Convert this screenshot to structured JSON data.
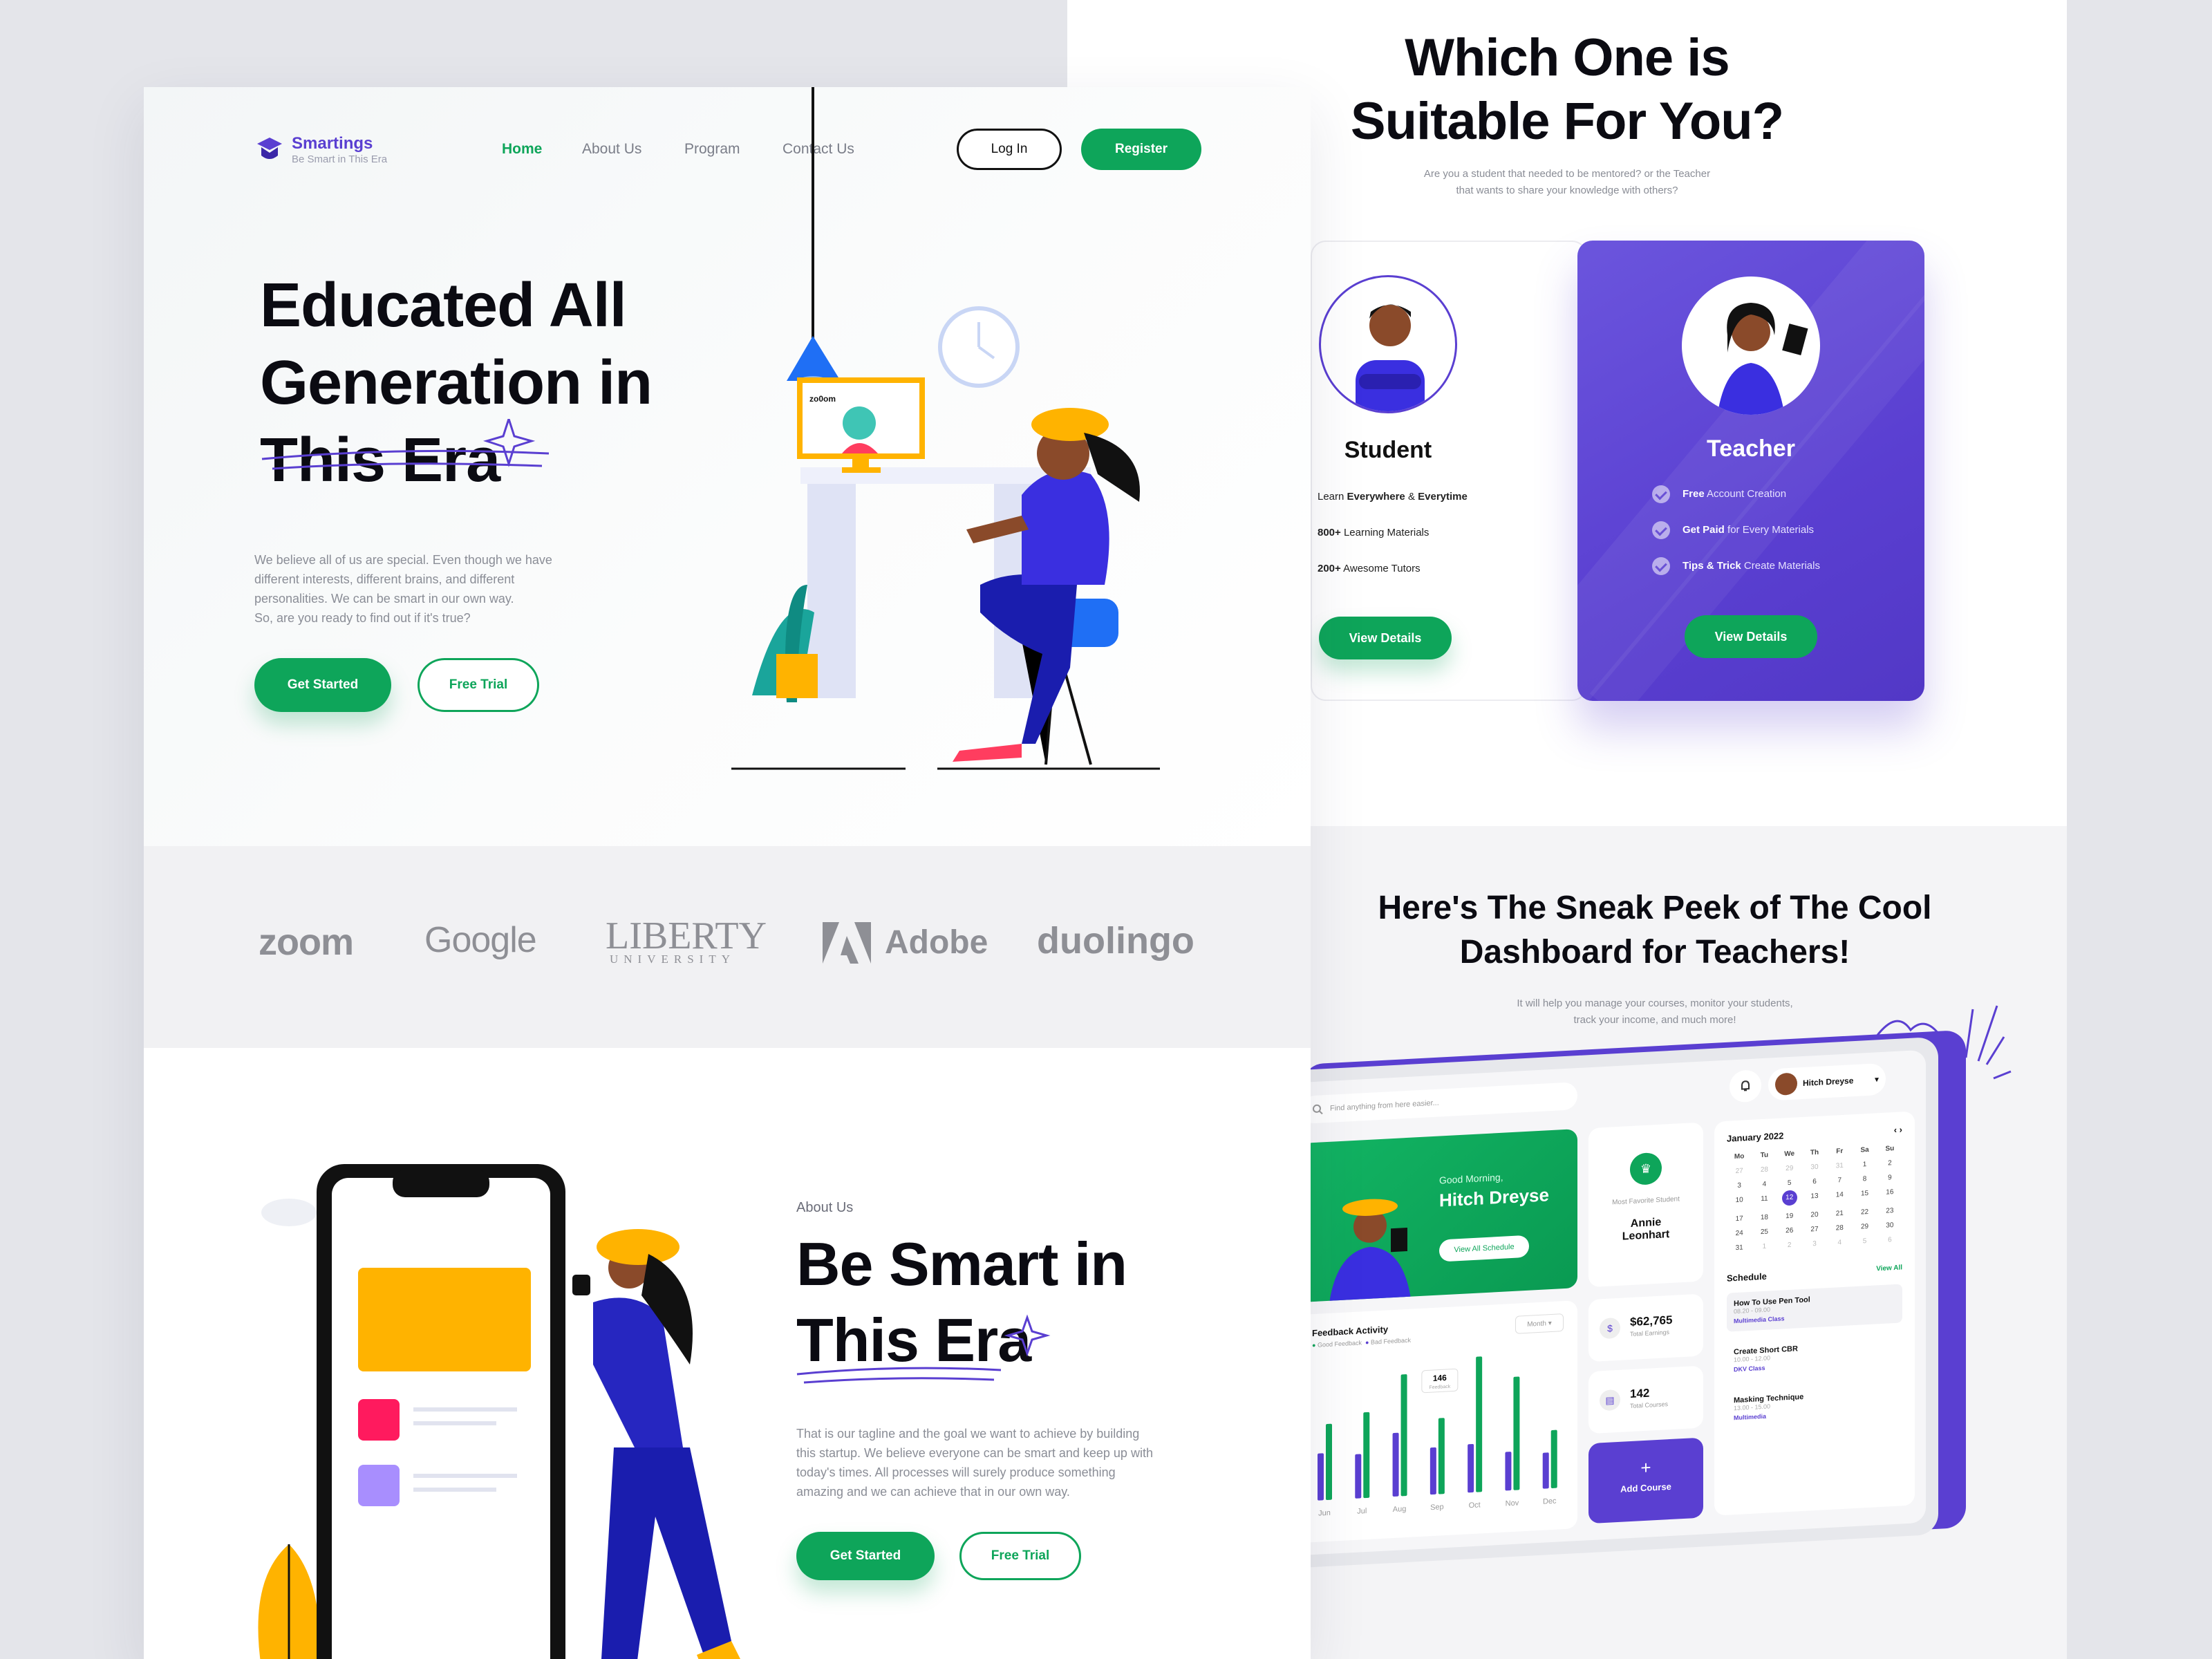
{
  "colors": {
    "green": "#0ea55a",
    "purple": "#5a3fd1",
    "dark": "#0b0b12",
    "gray": "#8a8d96"
  },
  "header": {
    "brand": "Smartings",
    "tagline": "Be Smart in This Era",
    "nav": [
      "Home",
      "About Us",
      "Program",
      "Contact Us"
    ],
    "login": "Log In",
    "register": "Register"
  },
  "hero": {
    "title_lines": [
      "Educated All",
      "Generation in",
      "This Era"
    ],
    "desc_lines": [
      "We believe all of us are special. Even though we have",
      "different interests, different brains, and different",
      "personalities. We can be smart in our own way.",
      "So, are you ready to find out if it's true?"
    ],
    "get_started": "Get Started",
    "free_trial": "Free Trial",
    "screen_label": "zo0om"
  },
  "partners": [
    "zoom",
    "Google",
    "LIBERTY",
    "UNIVERSITY",
    "Adobe",
    "duolingo"
  ],
  "about": {
    "kicker": "About Us",
    "title_lines": [
      "Be Smart in",
      "This Era"
    ],
    "desc_lines": [
      "That is our tagline and the goal we want to achieve by building",
      "this startup. We believe everyone can be smart and keep up with",
      "today's times. All processes will surely produce something",
      "amazing and we can achieve that in our own way."
    ],
    "get_started": "Get Started",
    "free_trial": "Free Trial"
  },
  "choose": {
    "title_lines": [
      "Which One is",
      "Suitable For You?"
    ],
    "sub_lines": [
      "Are you a student that needed to be mentored? or the Teacher",
      "that wants to share your knowledge with others?"
    ],
    "student": {
      "title": "Student",
      "items": [
        {
          "b": "",
          "t": "Learn "
        },
        {
          "b": "Everywhere",
          "t": " & "
        },
        {
          "b": "Everytime",
          "t": ""
        }
      ],
      "line1_pre": "Learn ",
      "line1_b1": "Everywhere",
      "line1_mid": " & ",
      "line1_b2": "Everytime",
      "line2_b": "800+",
      "line2_t": " Learning Materials",
      "line3_b": "200+",
      "line3_t": " Awesome Tutors",
      "button": "View Details"
    },
    "teacher": {
      "title": "Teacher",
      "line1_b": "Free",
      "line1_t": " Account Creation",
      "line2_b": "Get Paid",
      "line2_t": " for Every Materials",
      "line3_b": "Tips & Trick",
      "line3_t": " Create Materials",
      "button": "View Details"
    }
  },
  "peek": {
    "title_lines": [
      "Here's The Sneak Peek of The Cool",
      "Dashboard for Teachers!"
    ],
    "sub_lines": [
      "It will help you manage your courses, monitor your students,",
      "track your income, and much more!"
    ]
  },
  "dashboard": {
    "search_placeholder": "Find anything from here easier...",
    "user": "Hitch Dreyse",
    "greeting": "Good Morning,",
    "greeting_name": "Hitch Dreyse",
    "view_schedule": "View All Schedule",
    "fav_label": "Most Favorite Student",
    "fav_name_1": "Annie",
    "fav_name_2": "Leonhart",
    "earnings": "$62,765",
    "earnings_label": "Total Earnings",
    "courses": "142",
    "courses_label": "Total Courses",
    "add_course": "Add Course",
    "feedback_title": "Feedback Activity",
    "feedback_legend": [
      "Good Feedback",
      "Bad Feedback"
    ],
    "feedback_filter": "Month",
    "feedback_tooltip": "146",
    "feedback_tooltip_label": "Feedback",
    "months": [
      "Jun",
      "Jul",
      "Aug",
      "Sep",
      "Oct",
      "Nov",
      "Dec"
    ],
    "good": [
      0.55,
      0.62,
      0.88,
      0.55,
      0.98,
      0.82,
      0.42
    ],
    "bad": [
      0.34,
      0.32,
      0.46,
      0.34,
      0.35,
      0.28,
      0.26
    ],
    "calendar_title": "January 2022",
    "weekdays": [
      "Mo",
      "Tu",
      "We",
      "Th",
      "Fr",
      "Sa",
      "Su"
    ],
    "calendar_days": [
      "27",
      "28",
      "29",
      "30",
      "31",
      "1",
      "2",
      "3",
      "4",
      "5",
      "6",
      "7",
      "8",
      "9",
      "10",
      "11",
      "12",
      "13",
      "14",
      "15",
      "16",
      "17",
      "18",
      "19",
      "20",
      "21",
      "22",
      "23",
      "24",
      "25",
      "26",
      "27",
      "28",
      "29",
      "30",
      "31",
      "1",
      "2",
      "3",
      "4",
      "5",
      "6"
    ],
    "schedule_title": "Schedule",
    "schedule_view_all": "View All",
    "schedule": [
      {
        "title": "How To Use Pen Tool",
        "time": "08.20 - 09.00",
        "tag": "Multimedia Class"
      },
      {
        "title": "Create Short CBR",
        "time": "10.00 - 12.00",
        "tag": "DKV Class"
      },
      {
        "title": "Masking Technique",
        "time": "13.00 - 15.00",
        "tag": "Multimedia"
      }
    ]
  }
}
